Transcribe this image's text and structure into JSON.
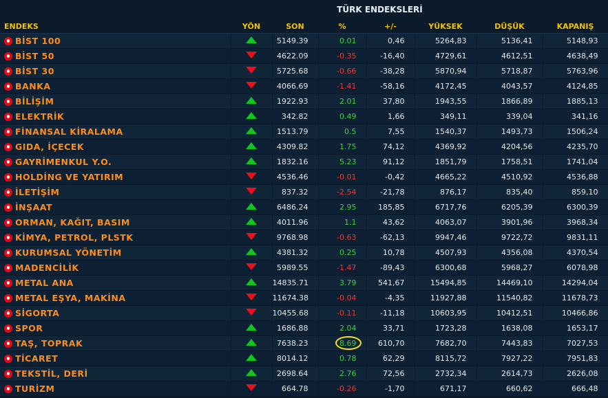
{
  "header": {
    "title": "TÜRK ENDEKSLERİ"
  },
  "columns": [
    "ENDEKS",
    "YÖN",
    "SON",
    "%",
    "+/-",
    "YÜKSEK",
    "DÜŞÜK",
    "KAPANIŞ"
  ],
  "rows": [
    {
      "name": "BİST 100",
      "dir": "up",
      "son": "5149.39",
      "pct": "0.01",
      "chg": "0,46",
      "hi": "5264,83",
      "lo": "5136,41",
      "cl": "5148,93"
    },
    {
      "name": "BİST 50",
      "dir": "down",
      "son": "4622.09",
      "pct": "-0.35",
      "chg": "-16,40",
      "hi": "4729,61",
      "lo": "4612,51",
      "cl": "4638,49"
    },
    {
      "name": "BİST 30",
      "dir": "down",
      "son": "5725.68",
      "pct": "-0.66",
      "chg": "-38,28",
      "hi": "5870,94",
      "lo": "5718,87",
      "cl": "5763,96"
    },
    {
      "name": "BANKA",
      "dir": "down",
      "son": "4066.69",
      "pct": "-1.41",
      "chg": "-58,16",
      "hi": "4172,45",
      "lo": "4043,57",
      "cl": "4124,85"
    },
    {
      "name": "BİLİŞİM",
      "dir": "up",
      "son": "1922.93",
      "pct": "2.01",
      "chg": "37,80",
      "hi": "1943,55",
      "lo": "1866,89",
      "cl": "1885,13"
    },
    {
      "name": "ELEKTRİK",
      "dir": "up",
      "son": "342.82",
      "pct": "0.49",
      "chg": "1,66",
      "hi": "349,11",
      "lo": "339,04",
      "cl": "341,16"
    },
    {
      "name": "FİNANSAL KİRALAMA",
      "dir": "up",
      "son": "1513.79",
      "pct": "0.5",
      "chg": "7,55",
      "hi": "1540,37",
      "lo": "1493,73",
      "cl": "1506,24"
    },
    {
      "name": "GIDA, İÇECEK",
      "dir": "up",
      "son": "4309.82",
      "pct": "1.75",
      "chg": "74,12",
      "hi": "4369,92",
      "lo": "4204,56",
      "cl": "4235,70"
    },
    {
      "name": "GAYRİMENKUL Y.O.",
      "dir": "up",
      "son": "1832.16",
      "pct": "5.23",
      "chg": "91,12",
      "hi": "1851,79",
      "lo": "1758,51",
      "cl": "1741,04"
    },
    {
      "name": "HOLDİNG VE YATIRIM",
      "dir": "down",
      "son": "4536.46",
      "pct": "-0.01",
      "chg": "-0,42",
      "hi": "4665,22",
      "lo": "4510,92",
      "cl": "4536,88"
    },
    {
      "name": "İLETİŞİM",
      "dir": "down",
      "son": "837.32",
      "pct": "-2.54",
      "chg": "-21,78",
      "hi": "876,17",
      "lo": "835,40",
      "cl": "859,10"
    },
    {
      "name": "İNŞAAT",
      "dir": "up",
      "son": "6486.24",
      "pct": "2.95",
      "chg": "185,85",
      "hi": "6717,76",
      "lo": "6205,39",
      "cl": "6300,39"
    },
    {
      "name": "ORMAN, KAĞIT, BASIM",
      "dir": "up",
      "son": "4011.96",
      "pct": "1.1",
      "chg": "43,62",
      "hi": "4063,07",
      "lo": "3901,96",
      "cl": "3968,34"
    },
    {
      "name": "KİMYA, PETROL, PLSTK",
      "dir": "down",
      "son": "9768.98",
      "pct": "-0.63",
      "chg": "-62,13",
      "hi": "9947,46",
      "lo": "9722,72",
      "cl": "9831,11"
    },
    {
      "name": "KURUMSAL YÖNETİM",
      "dir": "up",
      "son": "4381.32",
      "pct": "0.25",
      "chg": "10,78",
      "hi": "4507,93",
      "lo": "4356,08",
      "cl": "4370,54"
    },
    {
      "name": "MADENCİLİK",
      "dir": "down",
      "son": "5989.55",
      "pct": "-1.47",
      "chg": "-89,43",
      "hi": "6300,68",
      "lo": "5968,27",
      "cl": "6078,98"
    },
    {
      "name": "METAL ANA",
      "dir": "up",
      "son": "14835.71",
      "pct": "3.79",
      "chg": "541,67",
      "hi": "15494,85",
      "lo": "14469,10",
      "cl": "14294,04"
    },
    {
      "name": "METAL EŞYA, MAKİNA",
      "dir": "down",
      "son": "11674.38",
      "pct": "-0.04",
      "chg": "-4,35",
      "hi": "11927,88",
      "lo": "11540,82",
      "cl": "11678,73"
    },
    {
      "name": "SİGORTA",
      "dir": "down",
      "son": "10455.68",
      "pct": "-0.11",
      "chg": "-11,18",
      "hi": "10603,95",
      "lo": "10412,51",
      "cl": "10466,86"
    },
    {
      "name": "SPOR",
      "dir": "up",
      "son": "1686.88",
      "pct": "2.04",
      "chg": "33,71",
      "hi": "1723,28",
      "lo": "1638,08",
      "cl": "1653,17"
    },
    {
      "name": "TAŞ, TOPRAK",
      "dir": "up",
      "son": "7638.23",
      "pct": "8.69",
      "chg": "610,70",
      "hi": "7682,70",
      "lo": "7443,83",
      "cl": "7027,53",
      "circled": true
    },
    {
      "name": "TİCARET",
      "dir": "up",
      "son": "8014.12",
      "pct": "0.78",
      "chg": "62,29",
      "hi": "8115,72",
      "lo": "7927,22",
      "cl": "7951,83"
    },
    {
      "name": "TEKSTİL, DERİ",
      "dir": "up",
      "son": "2698.64",
      "pct": "2.76",
      "chg": "72,56",
      "hi": "2732,34",
      "lo": "2614,73",
      "cl": "2626,08"
    },
    {
      "name": "TURİZM",
      "dir": "down",
      "son": "664.78",
      "pct": "-0.26",
      "chg": "-1,70",
      "hi": "671,17",
      "lo": "660,62",
      "cl": "666,48"
    }
  ],
  "colors": {
    "up": "#12c41e",
    "down": "#e8121c",
    "name": "#ff8c1a",
    "header": "#f2c200",
    "highlight": "#f3e21a"
  },
  "icons": {
    "up": "triangle-up-icon",
    "down": "triangle-down-icon",
    "flag": "turkish-flag-icon"
  }
}
